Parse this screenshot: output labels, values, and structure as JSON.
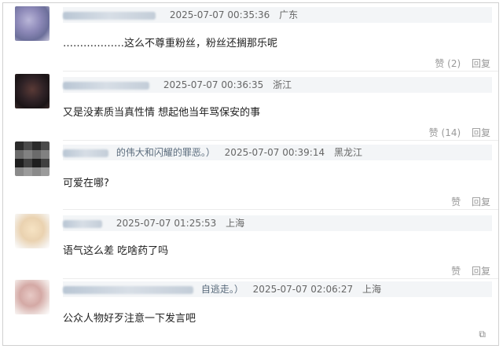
{
  "comments": [
    {
      "name_fragment": "",
      "time": "2025-07-07 00:35:36",
      "location": "广东",
      "text": "………………这么不尊重粉丝，粉丝还搁那乐呢",
      "like_label": "赞",
      "like_count": "(2)",
      "reply_label": "回复"
    },
    {
      "name_fragment": "",
      "time": "2025-07-07 00:36:35",
      "location": "浙江",
      "text": "又是没素质当真性情 想起他当年骂保安的事",
      "like_label": "赞",
      "like_count": "(14)",
      "reply_label": "回复"
    },
    {
      "name_fragment": "的伟大和闪耀的罪恶。）",
      "time": "2025-07-07 00:39:14",
      "location": "黑龙江",
      "text": "可爱在哪?",
      "like_label": "赞",
      "like_count": "",
      "reply_label": "回复"
    },
    {
      "name_fragment": "",
      "time": "2025-07-07 01:25:53",
      "location": "上海",
      "text": "语气这么差 吃啥药了吗",
      "like_label": "赞",
      "like_count": "",
      "reply_label": "回复"
    },
    {
      "name_fragment": "自逃走。）",
      "time": "2025-07-07 02:06:27",
      "location": "上海",
      "text": "公众人物好歹注意一下发言吧",
      "like_label": "赞",
      "like_count": "",
      "reply_label": "回复"
    }
  ],
  "icons": {
    "avatar_1": "avatar-blurred",
    "avatar_2": "avatar-dark",
    "avatar_3": "avatar-pixelated",
    "avatar_4": "avatar-light",
    "avatar_5": "avatar-pink",
    "corner": "camera-icon"
  }
}
